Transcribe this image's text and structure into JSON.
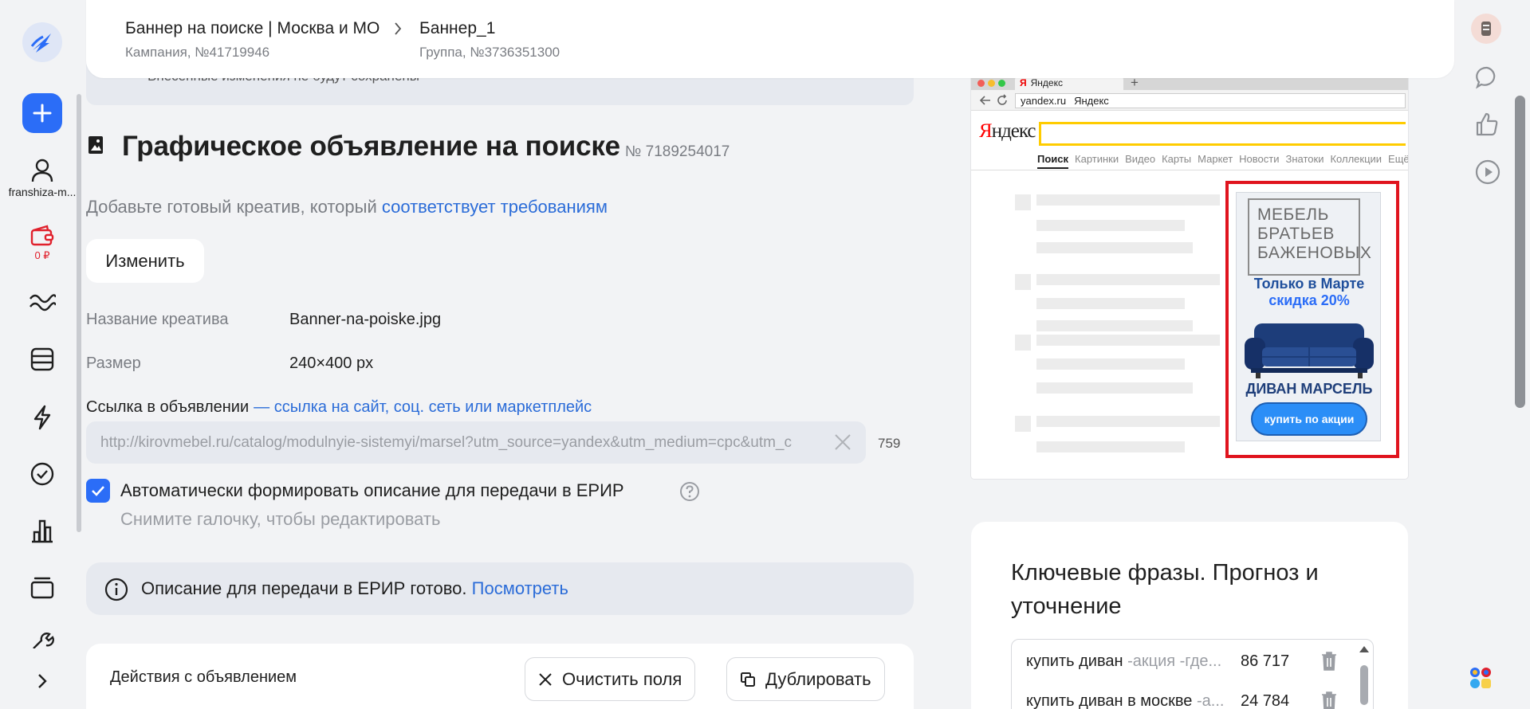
{
  "sidebar": {
    "account": "franshiza-m...",
    "balance": "0 ₽",
    "items": [
      {
        "icon": "user-icon"
      },
      {
        "icon": "wallet-icon"
      },
      {
        "icon": "stats-waves-icon"
      },
      {
        "icon": "campaigns-list-icon"
      },
      {
        "icon": "lightning-icon"
      },
      {
        "icon": "check-circle-icon"
      },
      {
        "icon": "bar-chart-icon"
      },
      {
        "icon": "layers-icon"
      },
      {
        "icon": "wrench-icon"
      }
    ]
  },
  "header": {
    "campaign_title": "Баннер на поиске | Москва и МО",
    "campaign_sub": "Кампания, №41719946",
    "group_title": "Баннер_1",
    "group_sub": "Группа, №3736351300"
  },
  "notice": "Внесенные изменения не будут сохранены",
  "ad": {
    "title": "Графическое объявление на поиске",
    "number": "№ 7189254017",
    "subtitle_text": "Добавьте готовый креатив, который ",
    "subtitle_link": "соответствует требованиям",
    "change_button": "Изменить",
    "creative_name_label": "Название креатива",
    "creative_name_value": "Banner-na-poiske.jpg",
    "size_label": "Размер",
    "size_value": "240×400 px",
    "link_label": "Ссылка в объявлении",
    "link_hint": "— ссылка на сайт, соц. сеть или маркетплейс",
    "link_value": "http://kirovmebel.ru/catalog/modulnyie-sistemyi/marsel?utm_source=yandex&utm_medium=cpc&utm_c",
    "link_count": "759",
    "auto_desc_label": "Автоматически формировать описание для передачи в ЕРИР",
    "auto_desc_hint": "Снимите галочку, чтобы редактировать",
    "erir_text": "Описание для передачи в ЕРИР готово. ",
    "erir_link": "Посмотреть",
    "actions_label": "Действия с объявлением",
    "clear_button": "Очистить поля",
    "duplicate_button": "Дублировать"
  },
  "preview": {
    "tab_label": "Яндекс",
    "tab_logo": "Я",
    "address": "yandex.ru",
    "address_title": "Яндекс",
    "logo_first": "Я",
    "logo_rest": "ндекс",
    "nav": [
      "Поиск",
      "Картинки",
      "Видео",
      "Карты",
      "Маркет",
      "Новости",
      "Знатоки",
      "Коллекции",
      "Ещё"
    ],
    "banner": {
      "brand_lines": [
        "МЕБЕЛЬ",
        "БРАТЬЕВ",
        "БАЖЕНОВЫХ"
      ],
      "promo_line1": "Только в Марте",
      "promo_line2": "скидка 20%",
      "product": "ДИВАН МАРСЕЛЬ",
      "cta": "купить по акции"
    }
  },
  "keywords": {
    "title": "Ключевые фразы. Прогноз и уточнение",
    "rows": [
      {
        "phrase": "купить диван",
        "minus": " -акция -где...",
        "count": "86 717"
      },
      {
        "phrase": "купить диван в москве",
        "minus": " -а...",
        "count": "24 784"
      }
    ]
  },
  "rail": {
    "items": [
      {
        "icon": "avatar"
      },
      {
        "icon": "chat-icon"
      },
      {
        "icon": "thumbs-up-icon"
      },
      {
        "icon": "play-icon"
      },
      {
        "icon": "apps-grid-icon"
      }
    ]
  },
  "colors": {
    "accent": "#2b6df7",
    "link": "#2b6cd8",
    "danger": "#e0202c",
    "background": "#f2f3f5"
  }
}
